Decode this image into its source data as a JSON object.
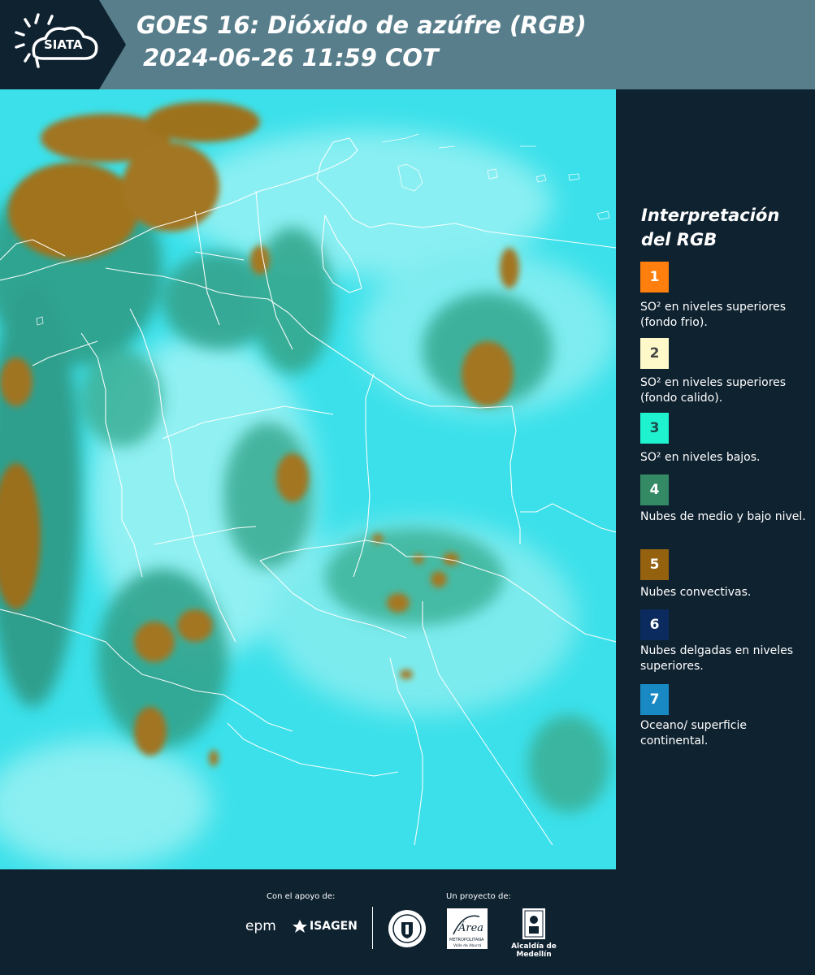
{
  "header": {
    "logo_text": "SIATA",
    "title_line1": "GOES 16: Dióxido de azúfre (RGB)",
    "title_line2": "2024-06-26 11:59 COT"
  },
  "legend": {
    "title": "Interpretación del RGB",
    "items": [
      {
        "number": "1",
        "color": "#ff7f0e",
        "number_color": "#ffffff",
        "text": "SO² en niveles superiores (fondo frio)."
      },
      {
        "number": "2",
        "color": "#fff9c9",
        "number_color": "#444444",
        "text": "SO² en niveles superiores (fondo calido)."
      },
      {
        "number": "3",
        "color": "#1ff2cf",
        "number_color": "#1c4a4a",
        "text": "SO² en niveles bajos."
      },
      {
        "number": "4",
        "color": "#348a65",
        "number_color": "#ffffff",
        "text": "Nubes de medio y bajo nivel."
      },
      {
        "number": "5",
        "color": "#94610e",
        "number_color": "#ffffff",
        "text": "Nubes convectivas."
      },
      {
        "number": "6",
        "color": "#0b2b5e",
        "number_color": "#ffffff",
        "text": "Nubes delgadas en niveles superiores."
      },
      {
        "number": "7",
        "color": "#1989c4",
        "number_color": "#ffffff",
        "text": "Oceano/ superficie continental."
      }
    ]
  },
  "footer": {
    "support_label": "Con el apoyo de:",
    "project_label": "Un proyecto de:",
    "epm": "epm",
    "isagen": "ISAGEN",
    "amva_name": "Área",
    "amva_sub": "METROPOLITANA",
    "amva_sub2": "Valle de Aburrá",
    "alcaldia": "Alcaldía de Medellín"
  }
}
